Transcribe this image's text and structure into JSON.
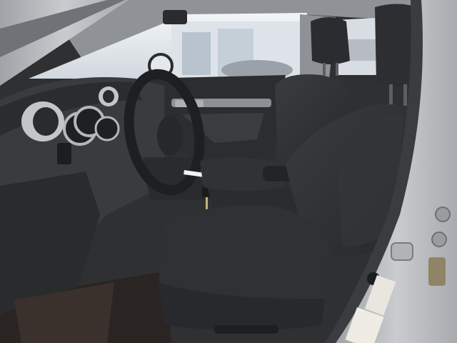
{
  "photo": {
    "subject": "car-interior-front-seats",
    "colors": {
      "upholstery": "#2e3033",
      "dashboard": "#3a3b3d",
      "door_frame_silver": "#b9bbbe",
      "floor_mat": "#2a2523",
      "windshield_light": "#e9edf2",
      "interior_lining": "#8e9296"
    }
  }
}
